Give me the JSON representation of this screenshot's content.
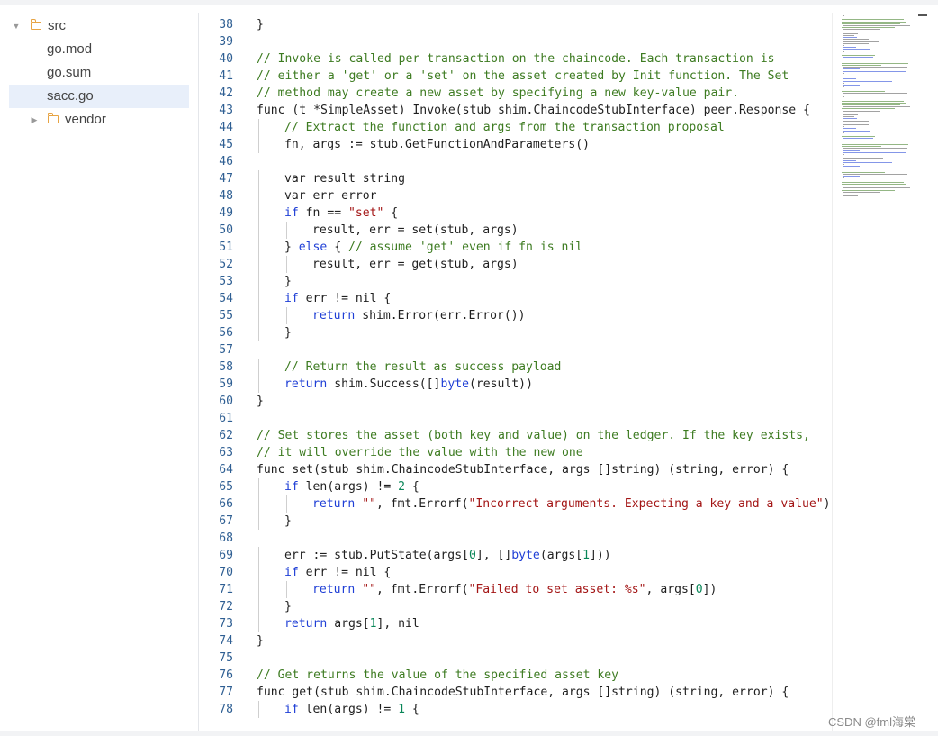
{
  "file_tree": [
    {
      "label": "src",
      "type": "folder",
      "expanded": true
    },
    {
      "label": "go.mod",
      "type": "file"
    },
    {
      "label": "go.sum",
      "type": "file"
    },
    {
      "label": "sacc.go",
      "type": "file",
      "selected": true
    },
    {
      "label": "vendor",
      "type": "folder",
      "expanded": false
    }
  ],
  "code_lines": [
    {
      "num": "38",
      "tokens": [
        [
          "t",
          "}"
        ]
      ]
    },
    {
      "num": "39",
      "tokens": []
    },
    {
      "num": "40",
      "tokens": [
        [
          "cm",
          "// Invoke is called per transaction on the chaincode. Each transaction is"
        ]
      ]
    },
    {
      "num": "41",
      "tokens": [
        [
          "cm",
          "// either a 'get' or a 'set' on the asset created by Init function. The Set"
        ]
      ]
    },
    {
      "num": "42",
      "tokens": [
        [
          "cm",
          "// method may create a new asset by specifying a new key-value pair."
        ]
      ]
    },
    {
      "num": "43",
      "tokens": [
        [
          "t",
          "func (t *SimpleAsset) Invoke(stub shim.ChaincodeStubInterface) peer.Response {"
        ]
      ]
    },
    {
      "num": "44",
      "tokens": [
        [
          "cm",
          "// Extract the function and args from the transaction proposal"
        ]
      ]
    },
    {
      "num": "45",
      "tokens": [
        [
          "t",
          "fn, args := stub.GetFunctionAndParameters()"
        ]
      ]
    },
    {
      "num": "46",
      "tokens": []
    },
    {
      "num": "47",
      "tokens": [
        [
          "t",
          "var result string"
        ]
      ]
    },
    {
      "num": "48",
      "tokens": [
        [
          "t",
          "var err error"
        ]
      ]
    },
    {
      "num": "49",
      "tokens": [
        [
          "kw",
          "if"
        ],
        [
          "t",
          " fn == "
        ],
        [
          "str",
          "\"set\""
        ],
        [
          "t",
          " {"
        ]
      ]
    },
    {
      "num": "50",
      "tokens": [
        [
          "t",
          "result, err = set(stub, args)"
        ]
      ]
    },
    {
      "num": "51",
      "tokens": [
        [
          "t",
          "} "
        ],
        [
          "kw",
          "else"
        ],
        [
          "t",
          " { "
        ],
        [
          "cm",
          "// assume 'get' even if fn is nil"
        ]
      ]
    },
    {
      "num": "52",
      "tokens": [
        [
          "t",
          "result, err = get(stub, args)"
        ]
      ]
    },
    {
      "num": "53",
      "tokens": [
        [
          "t",
          "}"
        ]
      ]
    },
    {
      "num": "54",
      "tokens": [
        [
          "kw",
          "if"
        ],
        [
          "t",
          " err != nil {"
        ]
      ]
    },
    {
      "num": "55",
      "tokens": [
        [
          "kw",
          "return"
        ],
        [
          "t",
          " shim.Error(err.Error())"
        ]
      ]
    },
    {
      "num": "56",
      "tokens": [
        [
          "t",
          "}"
        ]
      ]
    },
    {
      "num": "57",
      "tokens": []
    },
    {
      "num": "58",
      "tokens": [
        [
          "cm",
          "// Return the result as success payload"
        ]
      ]
    },
    {
      "num": "59",
      "tokens": [
        [
          "kw",
          "return"
        ],
        [
          "t",
          " shim.Success([]"
        ],
        [
          "kw",
          "byte"
        ],
        [
          "t",
          "(result))"
        ]
      ]
    },
    {
      "num": "60",
      "tokens": [
        [
          "t",
          "}"
        ]
      ]
    },
    {
      "num": "61",
      "tokens": []
    },
    {
      "num": "62",
      "tokens": [
        [
          "cm",
          "// Set stores the asset (both key and value) on the ledger. If the key exists,"
        ]
      ]
    },
    {
      "num": "63",
      "tokens": [
        [
          "cm",
          "// it will override the value with the new one"
        ]
      ]
    },
    {
      "num": "64",
      "tokens": [
        [
          "t",
          "func set(stub shim.ChaincodeStubInterface, args []string) (string, error) {"
        ]
      ]
    },
    {
      "num": "65",
      "tokens": [
        [
          "kw",
          "if"
        ],
        [
          "t",
          " len(args) != "
        ],
        [
          "num",
          "2"
        ],
        [
          "t",
          " {"
        ]
      ]
    },
    {
      "num": "66",
      "tokens": [
        [
          "kw",
          "return"
        ],
        [
          "t",
          " "
        ],
        [
          "str",
          "\"\""
        ],
        [
          "t",
          ", fmt.Errorf("
        ],
        [
          "str",
          "\"Incorrect arguments. Expecting a key and a value\""
        ],
        [
          "t",
          ")"
        ]
      ]
    },
    {
      "num": "67",
      "tokens": [
        [
          "t",
          "}"
        ]
      ]
    },
    {
      "num": "68",
      "tokens": []
    },
    {
      "num": "69",
      "tokens": [
        [
          "t",
          "err := stub.PutState(args["
        ],
        [
          "num",
          "0"
        ],
        [
          "t",
          "], []"
        ],
        [
          "kw",
          "byte"
        ],
        [
          "t",
          "(args["
        ],
        [
          "num",
          "1"
        ],
        [
          "t",
          "]))"
        ]
      ]
    },
    {
      "num": "70",
      "tokens": [
        [
          "kw",
          "if"
        ],
        [
          "t",
          " err != nil {"
        ]
      ]
    },
    {
      "num": "71",
      "tokens": [
        [
          "kw",
          "return"
        ],
        [
          "t",
          " "
        ],
        [
          "str",
          "\"\""
        ],
        [
          "t",
          ", fmt.Errorf("
        ],
        [
          "str",
          "\"Failed to set asset: %s\""
        ],
        [
          "t",
          ", args["
        ],
        [
          "num",
          "0"
        ],
        [
          "t",
          "])"
        ]
      ]
    },
    {
      "num": "72",
      "tokens": [
        [
          "t",
          "}"
        ]
      ]
    },
    {
      "num": "73",
      "tokens": [
        [
          "kw",
          "return"
        ],
        [
          "t",
          " args["
        ],
        [
          "num",
          "1"
        ],
        [
          "t",
          "], nil"
        ]
      ]
    },
    {
      "num": "74",
      "tokens": [
        [
          "t",
          "}"
        ]
      ]
    },
    {
      "num": "75",
      "tokens": []
    },
    {
      "num": "76",
      "tokens": [
        [
          "cm",
          "// Get returns the value of the specified asset key"
        ]
      ]
    },
    {
      "num": "77",
      "tokens": [
        [
          "t",
          "func get(stub shim.ChaincodeStubInterface, args []string) (string, error) {"
        ]
      ]
    },
    {
      "num": "78",
      "tokens": [
        [
          "kw",
          "if"
        ],
        [
          "t",
          " len(args) != "
        ],
        [
          "num",
          "1"
        ],
        [
          "t",
          " {"
        ]
      ]
    }
  ],
  "watermark": "CSDN @fml海棠",
  "colors": {
    "keyword": "#1f3fd6",
    "string": "#a31515",
    "number": "#098658",
    "comment": "#3d7b21",
    "line_number": "#2f5f93",
    "folder_icon": "#e7a444",
    "selected_row": "#e8effa"
  }
}
